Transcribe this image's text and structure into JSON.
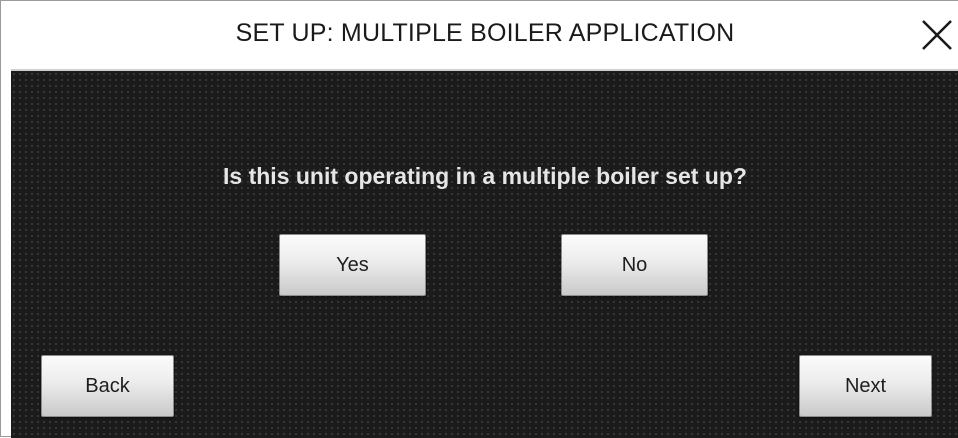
{
  "header": {
    "title": "SET UP: MULTIPLE BOILER APPLICATION",
    "close_icon": "close-icon"
  },
  "main": {
    "question": "Is this unit operating in a multiple boiler set up?",
    "yes_label": "Yes",
    "no_label": "No"
  },
  "footer": {
    "back_label": "Back",
    "next_label": "Next"
  },
  "colors": {
    "screen_background": "#1b1b1b",
    "question_text": "#e6e6e6",
    "button_face": "#ececec"
  }
}
